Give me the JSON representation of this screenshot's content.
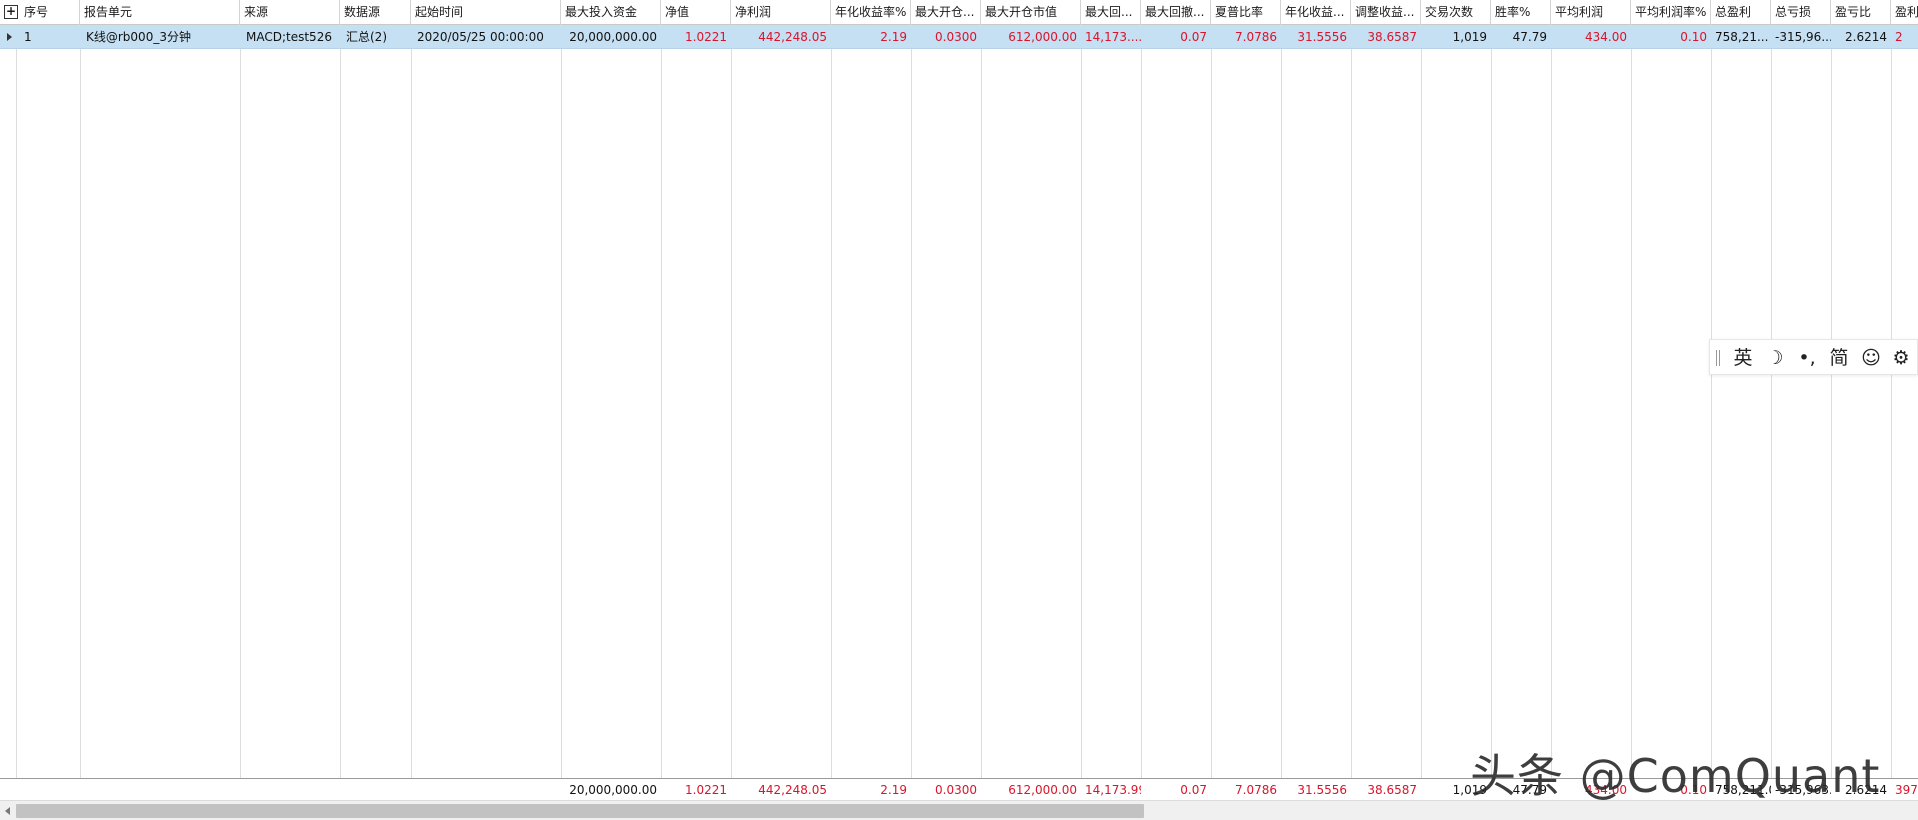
{
  "columns": [
    "序号",
    "报告单元",
    "来源",
    "数据源",
    "起始时间",
    "最大投入资金",
    "净值",
    "净利润",
    "年化收益率%",
    "最大开仓...",
    "最大开仓市值",
    "最大回...",
    "最大回撤...",
    "夏普比率",
    "年化收益...",
    "调整收益...",
    "交易次数",
    "胜率%",
    "平均利润",
    "平均利润率%",
    "总盈利",
    "总亏损",
    "盈亏比",
    "盈利"
  ],
  "row": {
    "index": "1",
    "report_unit": "K线@rb000_3分钟",
    "source": "MACD;test526",
    "data_source": "汇总(2)",
    "start_time": "2020/05/25 00:00:00",
    "max_capital": "20,000,000.00",
    "net_value": "1.0221",
    "net_profit": "442,248.05",
    "annual_return": "2.19",
    "max_open_ratio": "0.0300",
    "max_open_value": "612,000.00",
    "max_drawdown": "14,173....",
    "max_drawdown_pct": "0.07",
    "sharpe": "7.0786",
    "annual_return2": "31.5556",
    "adjusted_return": "38.6587",
    "trade_count": "1,019",
    "win_rate": "47.79",
    "avg_profit": "434.00",
    "avg_profit_rate": "0.10",
    "total_profit": "758,21...",
    "total_loss": "-315,96...",
    "profit_loss_ratio": "2.6214",
    "profit_cut": "2"
  },
  "footer": {
    "max_capital": "20,000,000.00",
    "net_value": "1.0221",
    "net_profit": "442,248.05",
    "annual_return": "2.19",
    "max_open_ratio": "0.0300",
    "max_open_value": "612,000.00",
    "max_drawdown": "14,173.99",
    "max_drawdown_pct": "0.07",
    "sharpe": "7.0786",
    "annual_return2": "31.5556",
    "adjusted_return": "38.6587",
    "trade_count": "1,019",
    "win_rate": "47.79",
    "avg_profit": "434.00",
    "avg_profit_rate": "0.10",
    "total_profit": "758,211.08",
    "total_loss": "-315,963.03",
    "profit_loss_ratio": "2.6214",
    "profit_cut": "397"
  },
  "ime": {
    "lang": "英",
    "moon": "☽",
    "punct": "•,",
    "simplified": "简",
    "emoji": "☺",
    "settings": "⚙"
  },
  "watermark": "头条 @ComQuant",
  "colors": {
    "selection": "#c5dff3",
    "value_red": "#d9142b"
  }
}
